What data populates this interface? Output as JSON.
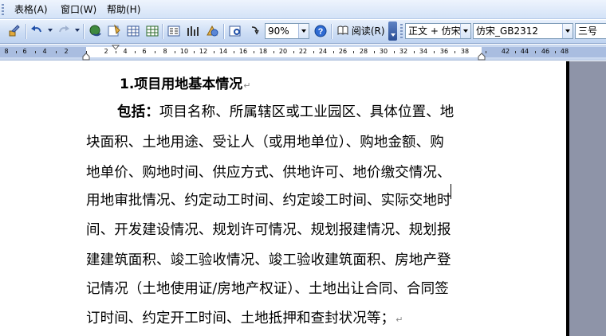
{
  "menubar": {
    "items": [
      {
        "label": "表格(A)"
      },
      {
        "label": "窗口(W)"
      },
      {
        "label": "帮助(H)"
      }
    ]
  },
  "toolbar": {
    "zoom": "90%",
    "read_label": "阅读(R)",
    "style": "正文 + 仿宋",
    "font": "仿宋_GB2312",
    "size": "三号"
  },
  "ruler": {
    "labels": [
      "8",
      "6",
      "4",
      "2",
      "2",
      "4",
      "6",
      "8",
      "10",
      "12",
      "14",
      "16",
      "18",
      "20",
      "22",
      "24",
      "26",
      "28",
      "30",
      "32",
      "34",
      "36",
      "38",
      "42",
      "44",
      "46",
      "48"
    ]
  },
  "document": {
    "heading": "1.项目用地基本情况",
    "para_mark": "↵",
    "lead": "包括：",
    "lines": [
      "项目名称、所属辖区或工业园区、具体位置、地",
      "块面积、土地用途、受让人（或用地单位）、购地金额、购",
      "地单价、购地时间、供应方式、供地许可、地价缴交情况、",
      "用地审批情况、约定动工时间、约定竣工时间、实际交地时",
      "间、开发建设情况、规划许可情况、规划报建情况、规划报",
      "建建筑面积、竣工验收情况、竣工验收建筑面积、房地产登",
      "记情况（土地使用证/房地产权证）、土地出让合同、合同签",
      "订时间、约定开工时间、土地抵押和查封状况等；"
    ]
  },
  "colors": {
    "toolbar_top": "#e9f1fc",
    "toolbar_bottom": "#bfd3f0",
    "gutter": "#8e94a8"
  }
}
